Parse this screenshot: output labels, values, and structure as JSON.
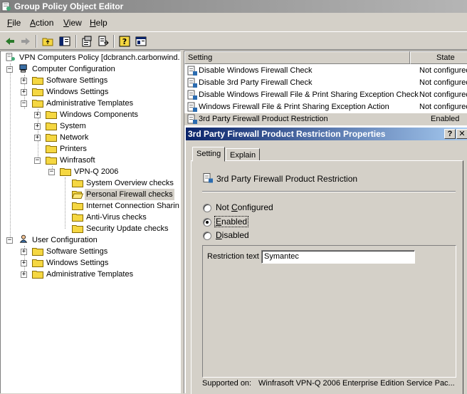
{
  "window": {
    "title": "Group Policy Object Editor"
  },
  "menu": [
    {
      "label": "File",
      "accel": "F",
      "rest": "ile"
    },
    {
      "label": "Action",
      "accel": "A",
      "rest": "ction"
    },
    {
      "label": "View",
      "accel": "V",
      "rest": "iew"
    },
    {
      "label": "Help",
      "accel": "H",
      "rest": "elp"
    }
  ],
  "toolbar": [
    "back-icon",
    "forward-icon",
    "up-folder-icon",
    "show-hide-tree-icon",
    "properties-icon",
    "export-icon",
    "help-icon",
    "console-icon"
  ],
  "tree": {
    "root": "VPN Computers Policy [dcbranch.carbonwind.n",
    "computer_config": "Computer Configuration",
    "cc_software": "Software Settings",
    "cc_windows": "Windows Settings",
    "cc_admin": "Administrative Templates",
    "windows_components": "Windows Components",
    "system": "System",
    "network": "Network",
    "printers": "Printers",
    "winfrasoft": "Winfrasoft",
    "vpnq": "VPN-Q 2006",
    "system_overview": "System Overview checks",
    "personal_firewall": "Personal Firewall checks",
    "ics": "Internet Connection Sharin",
    "antivirus": "Anti-Virus checks",
    "security_update": "Security Update checks",
    "user_config": "User Configuration",
    "uc_software": "Software Settings",
    "uc_windows": "Windows Settings",
    "uc_admin": "Administrative Templates"
  },
  "list": {
    "col_setting": "Setting",
    "col_state": "State",
    "rows": [
      {
        "setting": "Disable Windows Firewall Check",
        "state": "Not configured"
      },
      {
        "setting": "Disable 3rd Party Firewall Check",
        "state": "Not configured"
      },
      {
        "setting": "Disable Windows Firewall File & Print Sharing Exception Check",
        "state": "Not configured"
      },
      {
        "setting": "Windows Firewall File & Print Sharing Exception Action",
        "state": "Not configured"
      },
      {
        "setting": "3rd Party Firewall Product Restriction",
        "state": "Enabled"
      }
    ]
  },
  "dialog": {
    "title": "3rd Party Firewall Product Restriction Properties",
    "help_btn": "?",
    "close_btn": "✕",
    "tab_setting": "Setting",
    "tab_explain": "Explain",
    "policy_name": "3rd Party Firewall Product Restriction",
    "opt_not_configured": {
      "pre": "Not ",
      "accel": "C",
      "post": "onfigured"
    },
    "opt_enabled": {
      "pre": "",
      "accel": "E",
      "post": "nabled"
    },
    "opt_disabled": {
      "pre": "",
      "accel": "D",
      "post": "isabled"
    },
    "selected_option": "enabled",
    "restriction_label": "Restriction text",
    "restriction_value": "Symantec",
    "supported_label": "Supported on:",
    "supported_value": "Winfrasoft VPN-Q 2006 Enterprise Edition Service Pac..."
  }
}
